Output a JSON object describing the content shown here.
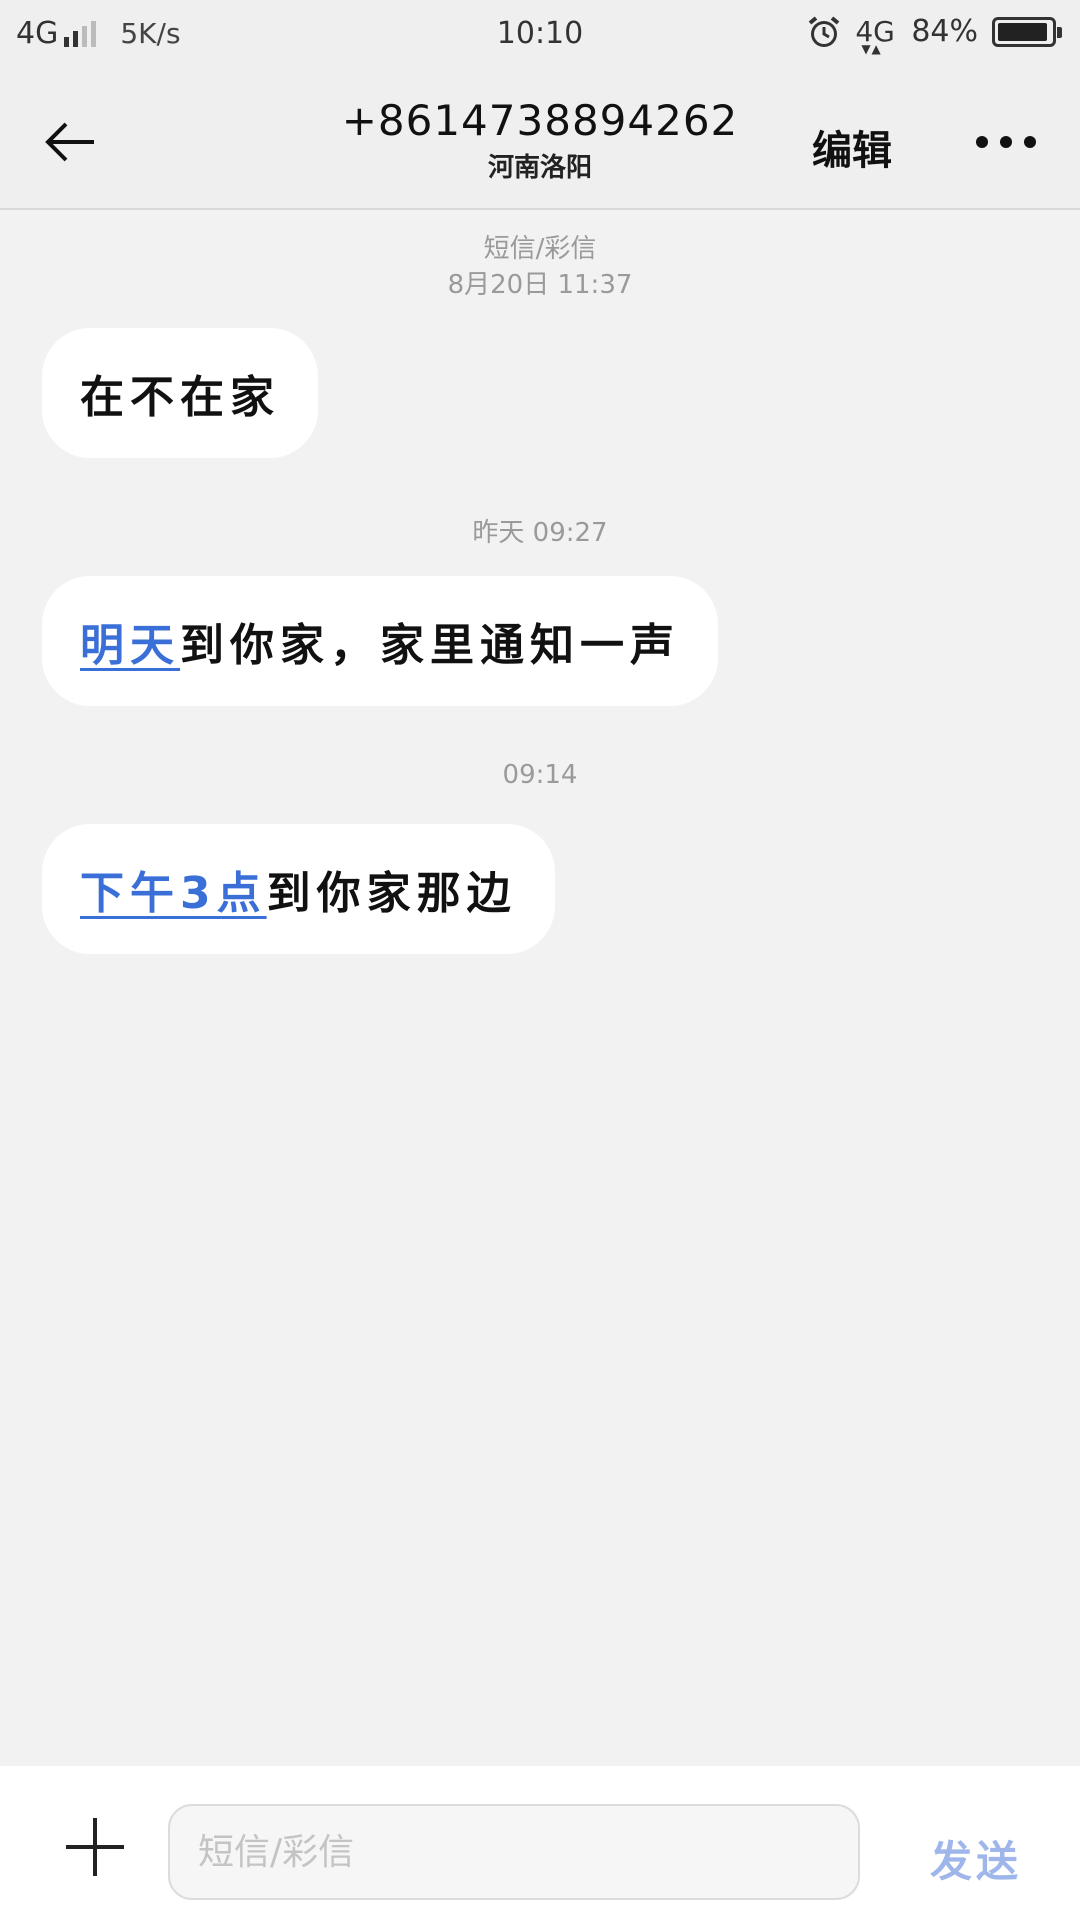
{
  "status_bar": {
    "network_left": "4G",
    "signal_icon": "signal-bars-icon",
    "speed": "5K/s",
    "time": "10:10",
    "alarm_icon": "alarm-clock-icon",
    "network_right": "4G",
    "data_arrows": "▼▲",
    "battery_percent": "84%",
    "battery_icon": "battery-icon"
  },
  "header": {
    "back_icon": "back-arrow-icon",
    "contact_number": "+8614738894262",
    "contact_location": "河南洛阳",
    "edit_label": "编辑",
    "more_icon": "more-dots-icon"
  },
  "conversation": {
    "type_label": "短信/彩信",
    "groups": [
      {
        "timestamp": "8月20日 11:37",
        "message": {
          "link": "",
          "text": "在不在家"
        }
      },
      {
        "timestamp": "昨天 09:27",
        "message": {
          "link": "明天",
          "text": "到你家，家里通知一声"
        }
      },
      {
        "timestamp": "09:14",
        "message": {
          "link": "下午3点",
          "text": "到你家那边"
        }
      }
    ]
  },
  "composer": {
    "add_icon": "plus-icon",
    "input_value": "",
    "placeholder": "短信/彩信",
    "send_label": "发送"
  },
  "colors": {
    "background": "#f2f2f2",
    "bubble": "#ffffff",
    "link": "#3a6fd8",
    "send_disabled": "#9fb6ea",
    "meta_text": "#9a9a9a"
  }
}
